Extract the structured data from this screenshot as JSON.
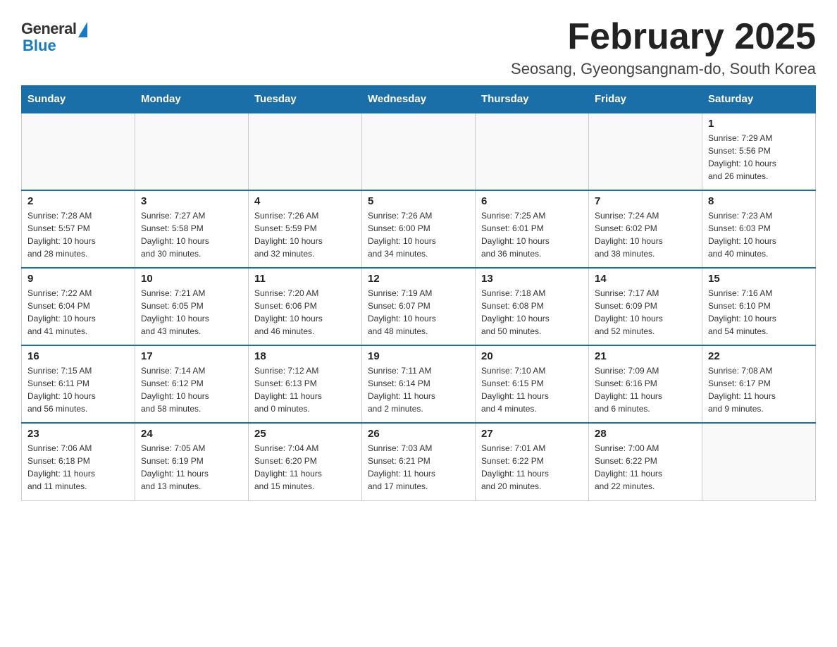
{
  "logo": {
    "general": "General",
    "blue": "Blue"
  },
  "title": "February 2025",
  "subtitle": "Seosang, Gyeongsangnam-do, South Korea",
  "weekdays": [
    "Sunday",
    "Monday",
    "Tuesday",
    "Wednesday",
    "Thursday",
    "Friday",
    "Saturday"
  ],
  "weeks": [
    [
      {
        "day": "",
        "info": ""
      },
      {
        "day": "",
        "info": ""
      },
      {
        "day": "",
        "info": ""
      },
      {
        "day": "",
        "info": ""
      },
      {
        "day": "",
        "info": ""
      },
      {
        "day": "",
        "info": ""
      },
      {
        "day": "1",
        "info": "Sunrise: 7:29 AM\nSunset: 5:56 PM\nDaylight: 10 hours\nand 26 minutes."
      }
    ],
    [
      {
        "day": "2",
        "info": "Sunrise: 7:28 AM\nSunset: 5:57 PM\nDaylight: 10 hours\nand 28 minutes."
      },
      {
        "day": "3",
        "info": "Sunrise: 7:27 AM\nSunset: 5:58 PM\nDaylight: 10 hours\nand 30 minutes."
      },
      {
        "day": "4",
        "info": "Sunrise: 7:26 AM\nSunset: 5:59 PM\nDaylight: 10 hours\nand 32 minutes."
      },
      {
        "day": "5",
        "info": "Sunrise: 7:26 AM\nSunset: 6:00 PM\nDaylight: 10 hours\nand 34 minutes."
      },
      {
        "day": "6",
        "info": "Sunrise: 7:25 AM\nSunset: 6:01 PM\nDaylight: 10 hours\nand 36 minutes."
      },
      {
        "day": "7",
        "info": "Sunrise: 7:24 AM\nSunset: 6:02 PM\nDaylight: 10 hours\nand 38 minutes."
      },
      {
        "day": "8",
        "info": "Sunrise: 7:23 AM\nSunset: 6:03 PM\nDaylight: 10 hours\nand 40 minutes."
      }
    ],
    [
      {
        "day": "9",
        "info": "Sunrise: 7:22 AM\nSunset: 6:04 PM\nDaylight: 10 hours\nand 41 minutes."
      },
      {
        "day": "10",
        "info": "Sunrise: 7:21 AM\nSunset: 6:05 PM\nDaylight: 10 hours\nand 43 minutes."
      },
      {
        "day": "11",
        "info": "Sunrise: 7:20 AM\nSunset: 6:06 PM\nDaylight: 10 hours\nand 46 minutes."
      },
      {
        "day": "12",
        "info": "Sunrise: 7:19 AM\nSunset: 6:07 PM\nDaylight: 10 hours\nand 48 minutes."
      },
      {
        "day": "13",
        "info": "Sunrise: 7:18 AM\nSunset: 6:08 PM\nDaylight: 10 hours\nand 50 minutes."
      },
      {
        "day": "14",
        "info": "Sunrise: 7:17 AM\nSunset: 6:09 PM\nDaylight: 10 hours\nand 52 minutes."
      },
      {
        "day": "15",
        "info": "Sunrise: 7:16 AM\nSunset: 6:10 PM\nDaylight: 10 hours\nand 54 minutes."
      }
    ],
    [
      {
        "day": "16",
        "info": "Sunrise: 7:15 AM\nSunset: 6:11 PM\nDaylight: 10 hours\nand 56 minutes."
      },
      {
        "day": "17",
        "info": "Sunrise: 7:14 AM\nSunset: 6:12 PM\nDaylight: 10 hours\nand 58 minutes."
      },
      {
        "day": "18",
        "info": "Sunrise: 7:12 AM\nSunset: 6:13 PM\nDaylight: 11 hours\nand 0 minutes."
      },
      {
        "day": "19",
        "info": "Sunrise: 7:11 AM\nSunset: 6:14 PM\nDaylight: 11 hours\nand 2 minutes."
      },
      {
        "day": "20",
        "info": "Sunrise: 7:10 AM\nSunset: 6:15 PM\nDaylight: 11 hours\nand 4 minutes."
      },
      {
        "day": "21",
        "info": "Sunrise: 7:09 AM\nSunset: 6:16 PM\nDaylight: 11 hours\nand 6 minutes."
      },
      {
        "day": "22",
        "info": "Sunrise: 7:08 AM\nSunset: 6:17 PM\nDaylight: 11 hours\nand 9 minutes."
      }
    ],
    [
      {
        "day": "23",
        "info": "Sunrise: 7:06 AM\nSunset: 6:18 PM\nDaylight: 11 hours\nand 11 minutes."
      },
      {
        "day": "24",
        "info": "Sunrise: 7:05 AM\nSunset: 6:19 PM\nDaylight: 11 hours\nand 13 minutes."
      },
      {
        "day": "25",
        "info": "Sunrise: 7:04 AM\nSunset: 6:20 PM\nDaylight: 11 hours\nand 15 minutes."
      },
      {
        "day": "26",
        "info": "Sunrise: 7:03 AM\nSunset: 6:21 PM\nDaylight: 11 hours\nand 17 minutes."
      },
      {
        "day": "27",
        "info": "Sunrise: 7:01 AM\nSunset: 6:22 PM\nDaylight: 11 hours\nand 20 minutes."
      },
      {
        "day": "28",
        "info": "Sunrise: 7:00 AM\nSunset: 6:22 PM\nDaylight: 11 hours\nand 22 minutes."
      },
      {
        "day": "",
        "info": ""
      }
    ]
  ]
}
